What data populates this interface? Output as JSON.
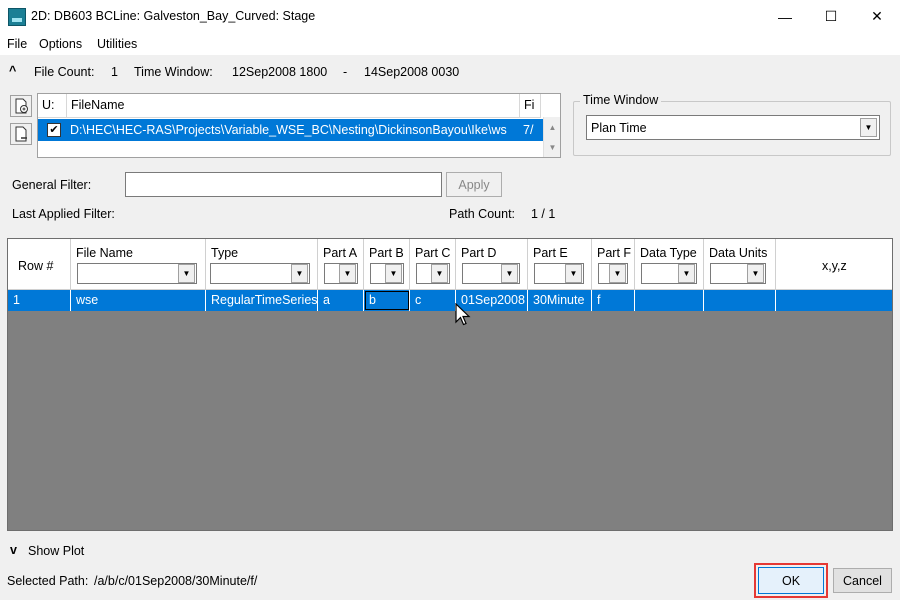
{
  "window": {
    "title": "2D: DB603 BCLine: Galveston_Bay_Curved: Stage",
    "minimize": "—",
    "maximize": "☐",
    "close": "✕"
  },
  "menu": [
    "File",
    "Options",
    "Utilities"
  ],
  "summary": {
    "collapse_glyph": "^",
    "file_count_label": "File Count:",
    "file_count": "1",
    "time_window_label": "Time Window:",
    "start": "12Sep2008 1800",
    "dash": "-",
    "end": "14Sep2008 0030"
  },
  "file_table": {
    "headers": [
      "U:",
      "FileName",
      "Fi"
    ],
    "row": {
      "checked": true,
      "filename": "D:\\HEC\\HEC-RAS\\Projects\\Variable_WSE_BC\\Nesting\\DickinsonBayou\\Ike\\ws",
      "fi": "7/"
    }
  },
  "time_window_group": {
    "caption": "Time Window",
    "selected": "Plan Time"
  },
  "filter": {
    "general_label": "General Filter:",
    "value": "",
    "apply_label": "Apply",
    "last_applied_label": "Last Applied Filter:",
    "path_count_label": "Path Count:",
    "path_count": "1 / 1"
  },
  "grid": {
    "headers": [
      "Row #",
      "File Name",
      "Type",
      "Part A",
      "Part B",
      "Part C",
      "Part D",
      "Part E",
      "Part F",
      "Data Type",
      "Data Units",
      "x,y,z"
    ],
    "rows": [
      [
        "1",
        "wse",
        "RegularTimeSeries",
        "a",
        "b",
        "c",
        "01Sep2008",
        "30Minute",
        "f",
        "",
        "",
        ""
      ]
    ]
  },
  "show_plot": {
    "glyph": "v",
    "label": "Show Plot"
  },
  "selected_path": {
    "label": "Selected Path:",
    "value": "/a/b/c/01Sep2008/30Minute/f/"
  },
  "buttons": {
    "ok": "OK",
    "cancel": "Cancel"
  },
  "colors": {
    "selection": "#0078d7",
    "highlight": "#e53935",
    "grid_background": "#808080"
  }
}
